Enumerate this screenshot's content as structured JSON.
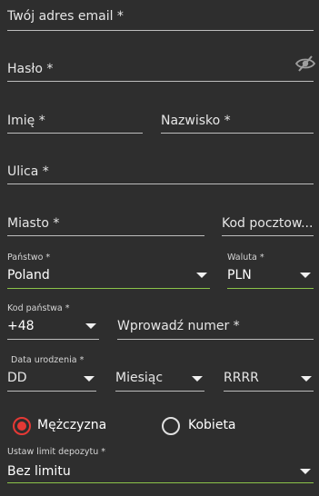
{
  "email": {
    "label": "Twój adres email *"
  },
  "password": {
    "label": "Hasło *",
    "toggle_icon": "eye-slash-icon"
  },
  "first_name": {
    "label": "Imię *"
  },
  "last_name": {
    "label": "Nazwisko *"
  },
  "street": {
    "label": "Ulica *"
  },
  "city": {
    "label": "Miasto *"
  },
  "postal_code": {
    "label": "Kod pocztow..."
  },
  "country": {
    "label": "Państwo *",
    "value": "Poland"
  },
  "currency": {
    "label": "Waluta *",
    "value": "PLN"
  },
  "phone_code": {
    "label": "Kod państwa *",
    "value": "+48"
  },
  "phone_number": {
    "label": "Wprowadź numer *"
  },
  "birth_date": {
    "label": "Data urodzenia *",
    "day": "DD",
    "month": "Miesiąc",
    "year": "RRRR"
  },
  "gender": {
    "male": "Mężczyzna",
    "female": "Kobieta",
    "selected": "male"
  },
  "deposit_limit": {
    "label": "Ustaw limit depozytu *",
    "value": "Bez limitu"
  },
  "colors": {
    "background": "#2e2e2e",
    "accent": "#e53935",
    "valid_underline": "#8bc34a",
    "underline": "#bdbdbd"
  }
}
